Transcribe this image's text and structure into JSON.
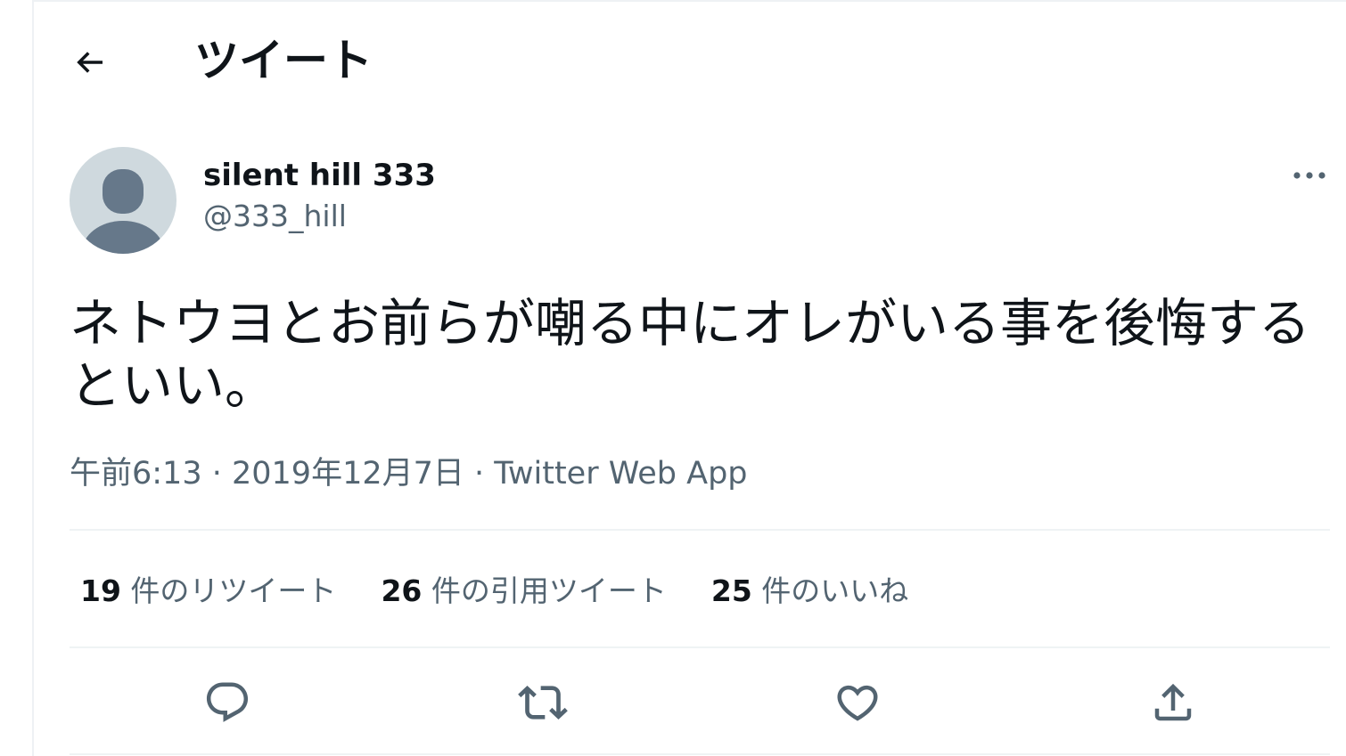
{
  "header": {
    "back_icon": "arrow-left-icon",
    "title": "ツイート"
  },
  "tweet": {
    "author": {
      "display_name": "silent hill 333",
      "handle": "@333_hill",
      "avatar_icon": "default-avatar-icon"
    },
    "more_icon": "more-dots-icon",
    "text": "ネトウヨとお前らが嘲る中にオレがいる事を後悔するといい。",
    "time": "午前6:13",
    "separator": " · ",
    "date": "2019年12月7日",
    "source": "Twitter Web App"
  },
  "stats": {
    "retweets": {
      "count": "19",
      "label": " 件のリツイート"
    },
    "quotes": {
      "count": "26",
      "label": " 件の引用ツイート"
    },
    "likes": {
      "count": "25",
      "label": " 件のいいね"
    }
  },
  "actions": [
    {
      "name": "reply",
      "icon": "reply-bubble-icon"
    },
    {
      "name": "retweet",
      "icon": "retweet-arrows-icon"
    },
    {
      "name": "like",
      "icon": "heart-icon"
    },
    {
      "name": "share",
      "icon": "share-upload-icon"
    }
  ],
  "colors": {
    "text_primary": "#0f1419",
    "text_secondary": "#536471",
    "avatar_bg": "#cfd9de",
    "avatar_fg": "#66788a",
    "divider": "#eff3f4"
  }
}
